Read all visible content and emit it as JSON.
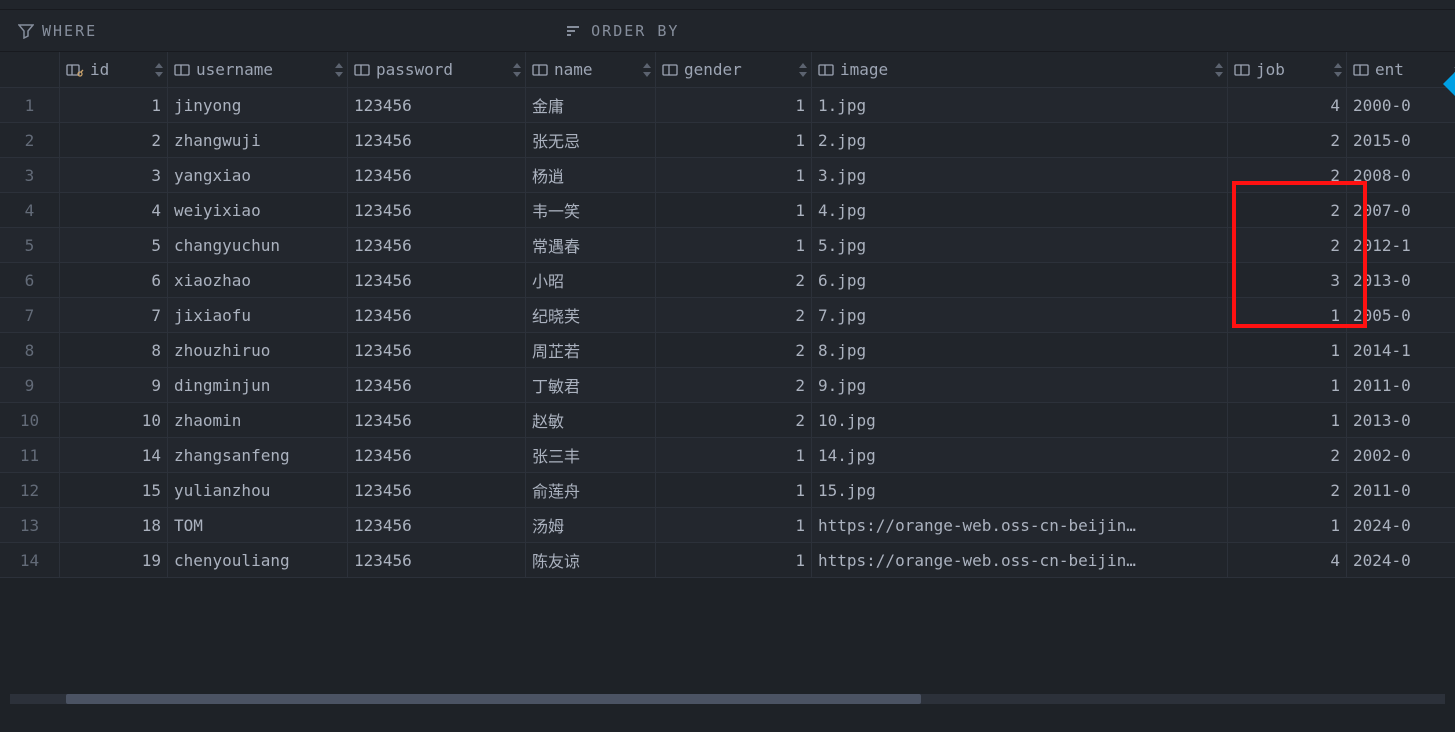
{
  "filters": {
    "where_label": "WHERE",
    "orderby_label": "ORDER BY"
  },
  "columns": [
    {
      "key": "id",
      "label": "id",
      "width": "col-id",
      "align": "num",
      "icon": "key"
    },
    {
      "key": "username",
      "label": "username",
      "width": "col-username",
      "align": "txt",
      "icon": "col"
    },
    {
      "key": "password",
      "label": "password",
      "width": "col-password",
      "align": "txt",
      "icon": "col"
    },
    {
      "key": "name",
      "label": "name",
      "width": "col-name",
      "align": "txt",
      "icon": "col"
    },
    {
      "key": "gender",
      "label": "gender",
      "width": "col-gender",
      "align": "num",
      "icon": "col"
    },
    {
      "key": "image",
      "label": "image",
      "width": "col-image",
      "align": "txt",
      "icon": "col"
    },
    {
      "key": "job",
      "label": "job",
      "width": "col-job",
      "align": "num",
      "icon": "col"
    },
    {
      "key": "ent",
      "label": "ent",
      "width": "col-ent",
      "align": "txt",
      "icon": "col"
    }
  ],
  "rows": [
    {
      "n": "1",
      "id": "1",
      "username": "jinyong",
      "password": "123456",
      "name": "金庸",
      "gender": "1",
      "image": "1.jpg",
      "job": "4",
      "ent": "2000-0"
    },
    {
      "n": "2",
      "id": "2",
      "username": "zhangwuji",
      "password": "123456",
      "name": "张无忌",
      "gender": "1",
      "image": "2.jpg",
      "job": "2",
      "ent": "2015-0"
    },
    {
      "n": "3",
      "id": "3",
      "username": "yangxiao",
      "password": "123456",
      "name": "杨逍",
      "gender": "1",
      "image": "3.jpg",
      "job": "2",
      "ent": "2008-0"
    },
    {
      "n": "4",
      "id": "4",
      "username": "weiyixiao",
      "password": "123456",
      "name": "韦一笑",
      "gender": "1",
      "image": "4.jpg",
      "job": "2",
      "ent": "2007-0"
    },
    {
      "n": "5",
      "id": "5",
      "username": "changyuchun",
      "password": "123456",
      "name": "常遇春",
      "gender": "1",
      "image": "5.jpg",
      "job": "2",
      "ent": "2012-1"
    },
    {
      "n": "6",
      "id": "6",
      "username": "xiaozhao",
      "password": "123456",
      "name": "小昭",
      "gender": "2",
      "image": "6.jpg",
      "job": "3",
      "ent": "2013-0"
    },
    {
      "n": "7",
      "id": "7",
      "username": "jixiaofu",
      "password": "123456",
      "name": "纪晓芙",
      "gender": "2",
      "image": "7.jpg",
      "job": "1",
      "ent": "2005-0"
    },
    {
      "n": "8",
      "id": "8",
      "username": "zhouzhiruo",
      "password": "123456",
      "name": "周芷若",
      "gender": "2",
      "image": "8.jpg",
      "job": "1",
      "ent": "2014-1"
    },
    {
      "n": "9",
      "id": "9",
      "username": "dingminjun",
      "password": "123456",
      "name": "丁敏君",
      "gender": "2",
      "image": "9.jpg",
      "job": "1",
      "ent": "2011-0"
    },
    {
      "n": "10",
      "id": "10",
      "username": "zhaomin",
      "password": "123456",
      "name": "赵敏",
      "gender": "2",
      "image": "10.jpg",
      "job": "1",
      "ent": "2013-0"
    },
    {
      "n": "11",
      "id": "14",
      "username": "zhangsanfeng",
      "password": "123456",
      "name": "张三丰",
      "gender": "1",
      "image": "14.jpg",
      "job": "2",
      "ent": "2002-0"
    },
    {
      "n": "12",
      "id": "15",
      "username": "yulianzhou",
      "password": "123456",
      "name": "俞莲舟",
      "gender": "1",
      "image": "15.jpg",
      "job": "2",
      "ent": "2011-0"
    },
    {
      "n": "13",
      "id": "18",
      "username": "TOM",
      "password": "123456",
      "name": "汤姆",
      "gender": "1",
      "image": "https://orange-web.oss-cn-beijin…",
      "job": "1",
      "ent": "2024-0"
    },
    {
      "n": "14",
      "id": "19",
      "username": "chenyouliang",
      "password": "123456",
      "name": "陈友谅",
      "gender": "1",
      "image": "https://orange-web.oss-cn-beijin…",
      "job": "4",
      "ent": "2024-0"
    }
  ]
}
